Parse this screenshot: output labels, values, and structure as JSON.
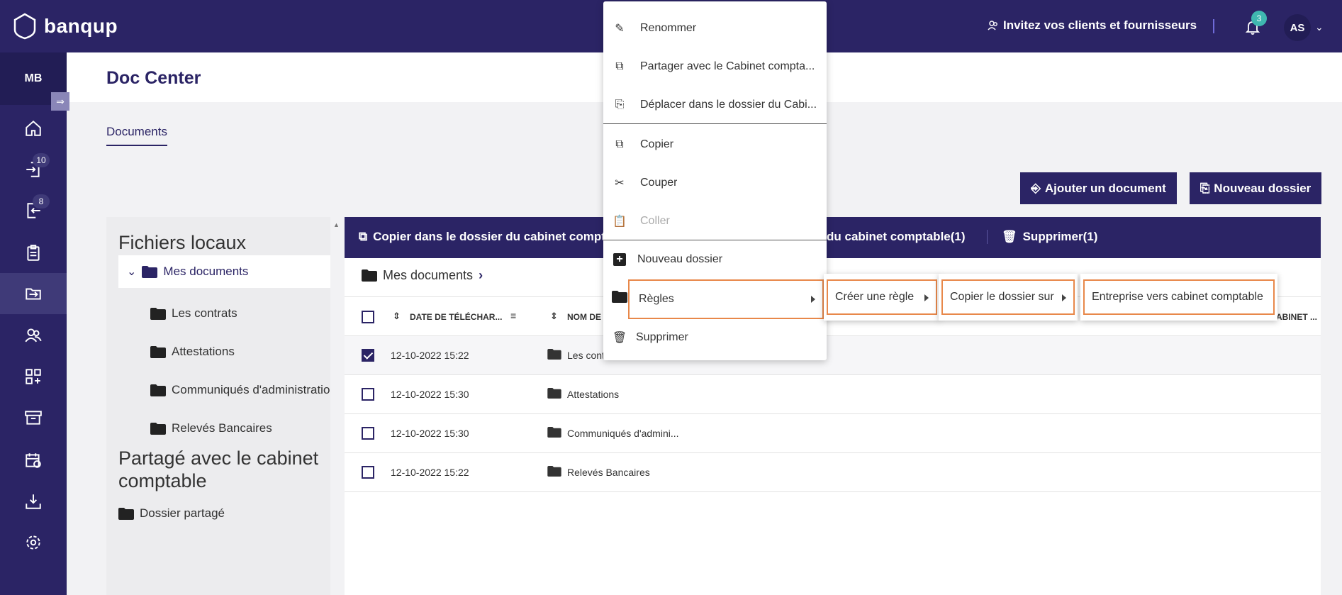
{
  "app": {
    "brand": "banqup"
  },
  "topbar": {
    "invite_label": "Invitez vos clients et fournisseurs",
    "notifications_count": "3",
    "avatar_initials": "AS"
  },
  "sidebar": {
    "org_initials": "MB",
    "items": [
      {
        "icon": "home-icon"
      },
      {
        "icon": "inbox-in-icon",
        "badge": "10"
      },
      {
        "icon": "outbox-icon",
        "badge": "8"
      },
      {
        "icon": "clipboard-icon"
      },
      {
        "icon": "doc-center-icon",
        "active": true
      },
      {
        "icon": "contacts-icon"
      },
      {
        "icon": "apps-icon"
      },
      {
        "icon": "archive-icon"
      },
      {
        "icon": "calendar-sync-icon"
      },
      {
        "icon": "download-icon"
      },
      {
        "icon": "settings-icon"
      }
    ]
  },
  "page": {
    "title": "Doc Center",
    "tab_label": "Documents",
    "add_document_label": "Ajouter un document",
    "new_folder_label": "Nouveau dossier"
  },
  "tree": {
    "local_heading": "Fichiers locaux",
    "root_label": "Mes documents",
    "children": [
      "Les contrats",
      "Attestations",
      "Communiqués d'administratio",
      "Relevés Bancaires"
    ],
    "shared_heading": "Partagé avec le cabinet comptable",
    "shared_folder": "Dossier partagé"
  },
  "action_bar": {
    "copy_label": "Copier dans le dossier du cabinet compta",
    "move_label": "du cabinet comptable(1)",
    "delete_label": "Supprimer(1)"
  },
  "breadcrumb": {
    "label": "Mes documents"
  },
  "table": {
    "col_date": "DATE DE TÉLÉCHAR...",
    "col_name": "NOM DE",
    "col_last": "ABINET ...",
    "rows": [
      {
        "date": "12-10-2022 15:22",
        "name": "Les cont",
        "checked": true
      },
      {
        "date": "12-10-2022 15:30",
        "name": "Attestations",
        "checked": false
      },
      {
        "date": "12-10-2022 15:30",
        "name": "Communiqués d'admini...",
        "checked": false
      },
      {
        "date": "12-10-2022 15:22",
        "name": "Relevés Bancaires",
        "checked": false
      }
    ]
  },
  "context_menu": {
    "rename": "Renommer",
    "share": "Partager avec le Cabinet compta...",
    "move": "Déplacer dans le dossier du Cabi...",
    "copy": "Copier",
    "cut": "Couper",
    "paste": "Coller",
    "new_folder": "Nouveau dossier",
    "rules": "Règles",
    "delete": "Supprimer"
  },
  "submenus": {
    "create_rule": "Créer une règle",
    "copy_folder_to": "Copier le dossier sur",
    "company_to_firm": "Entreprise vers cabinet comptable"
  },
  "colors": {
    "primary": "#2b2465",
    "highlight": "#e8884a",
    "badge_teal": "#3fb7b0"
  }
}
